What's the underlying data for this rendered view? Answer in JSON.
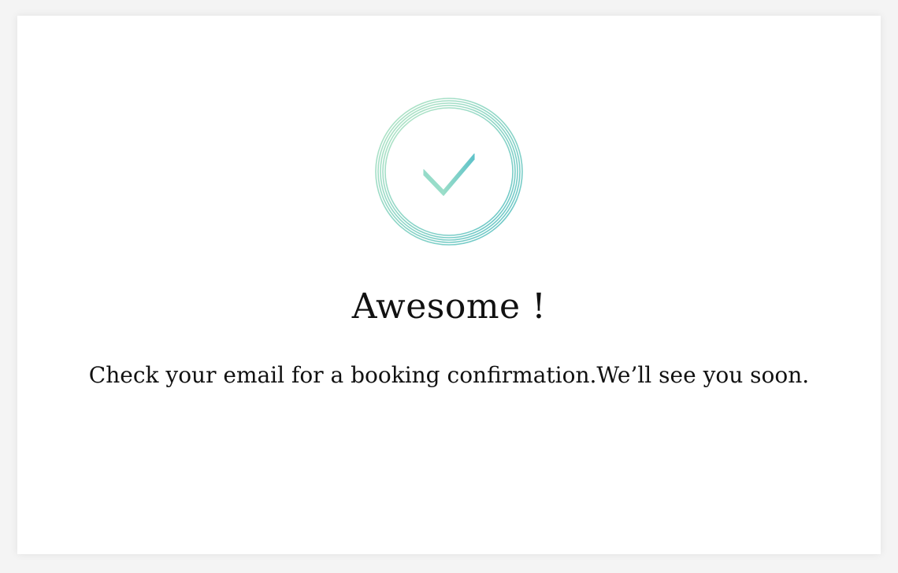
{
  "confirmation": {
    "icon": "check-circle-icon",
    "title": "Awesome !",
    "message": "Check your email for a booking confirmation.We’ll see you soon."
  },
  "colors": {
    "card_background": "#ffffff",
    "page_background": "#f4f4f4",
    "text": "#111111",
    "badge_gradient_start": "#aee3c2",
    "badge_gradient_end": "#6cc8c8"
  }
}
